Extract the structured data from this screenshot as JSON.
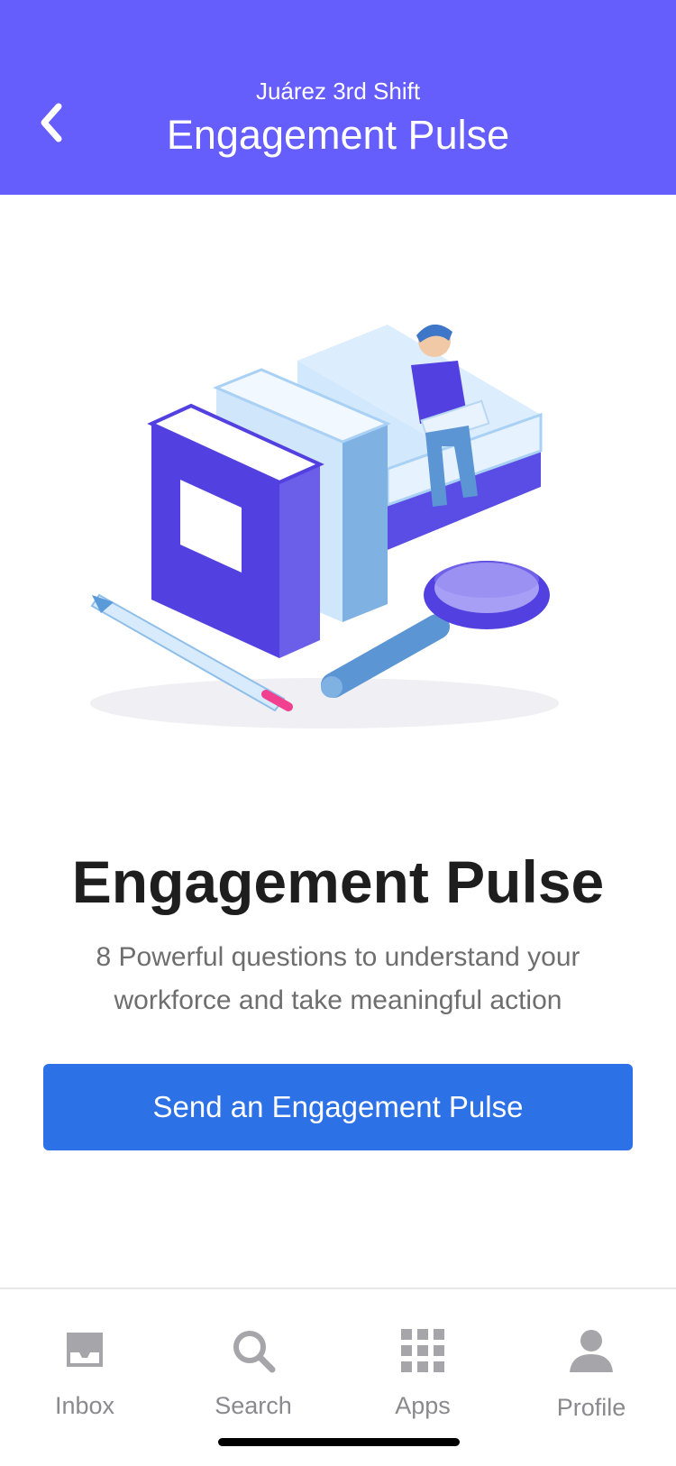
{
  "header": {
    "subtitle": "Juárez 3rd Shift",
    "title": "Engagement Pulse",
    "back_icon": "chevron-left-icon"
  },
  "hero": {
    "title": "Engagement Pulse",
    "description": "8 Powerful questions to understand your workforce and take meaningful action",
    "button_label": "Send an Engagement Pulse"
  },
  "tabbar": {
    "items": [
      {
        "label": "Inbox",
        "icon": "inbox-icon"
      },
      {
        "label": "Search",
        "icon": "search-icon"
      },
      {
        "label": "Apps",
        "icon": "grid-icon"
      },
      {
        "label": "Profile",
        "icon": "person-icon"
      }
    ]
  },
  "colors": {
    "header_bg": "#665efc",
    "button_bg": "#2d71e6",
    "accent_purple": "#5241e0"
  }
}
